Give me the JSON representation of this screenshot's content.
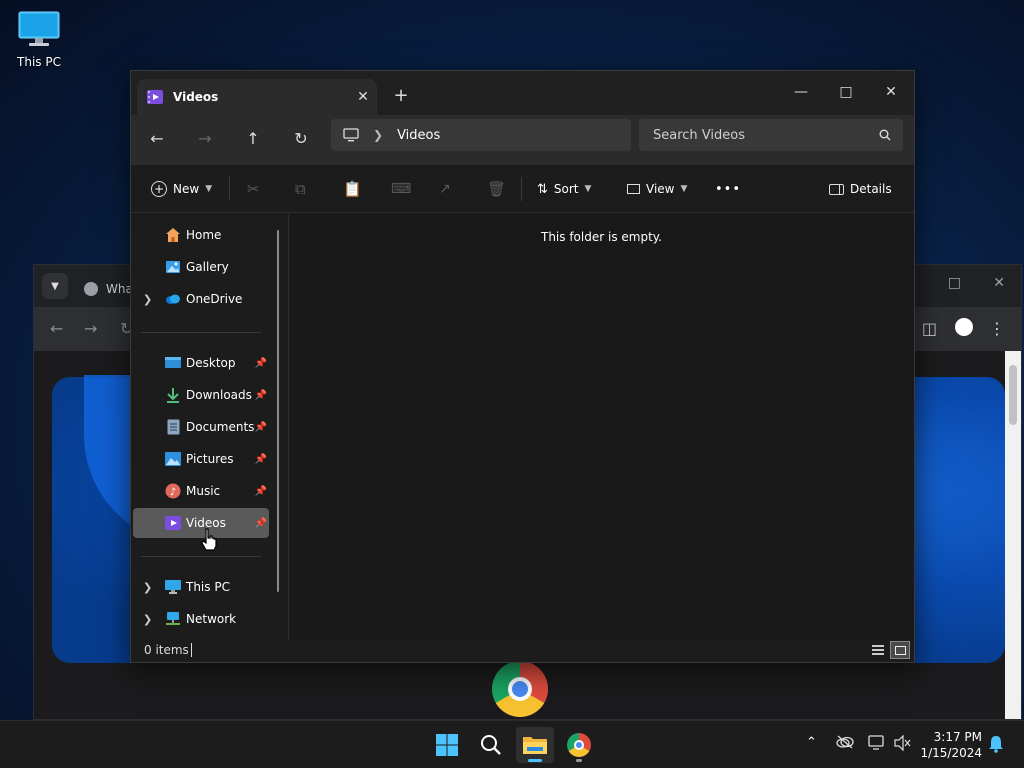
{
  "desktop": {
    "this_pc_label": "This PC"
  },
  "browser_bg": {
    "tab_title": "Wha"
  },
  "explorer": {
    "tab_title": "Videos",
    "new_tab_symbol": "+",
    "address": {
      "crumb": "Videos"
    },
    "search": {
      "placeholder": "Search Videos"
    },
    "commands": {
      "new": "New",
      "sort": "Sort",
      "view": "View",
      "more": "•••",
      "details": "Details"
    },
    "nav": {
      "home": "Home",
      "gallery": "Gallery",
      "onedrive": "OneDrive",
      "desktop": "Desktop",
      "downloads": "Downloads",
      "documents": "Documents",
      "pictures": "Pictures",
      "music": "Music",
      "videos": "Videos",
      "this_pc": "This PC",
      "network": "Network"
    },
    "empty_message": "This folder is empty.",
    "status": {
      "item_count": "0 items"
    }
  },
  "taskbar": {
    "time": "3:17 PM",
    "date": "1/15/2024"
  },
  "colors": {
    "accent": "#4cc2ff",
    "selected_nav": "#5a5a5a",
    "window_bg": "#191919"
  }
}
